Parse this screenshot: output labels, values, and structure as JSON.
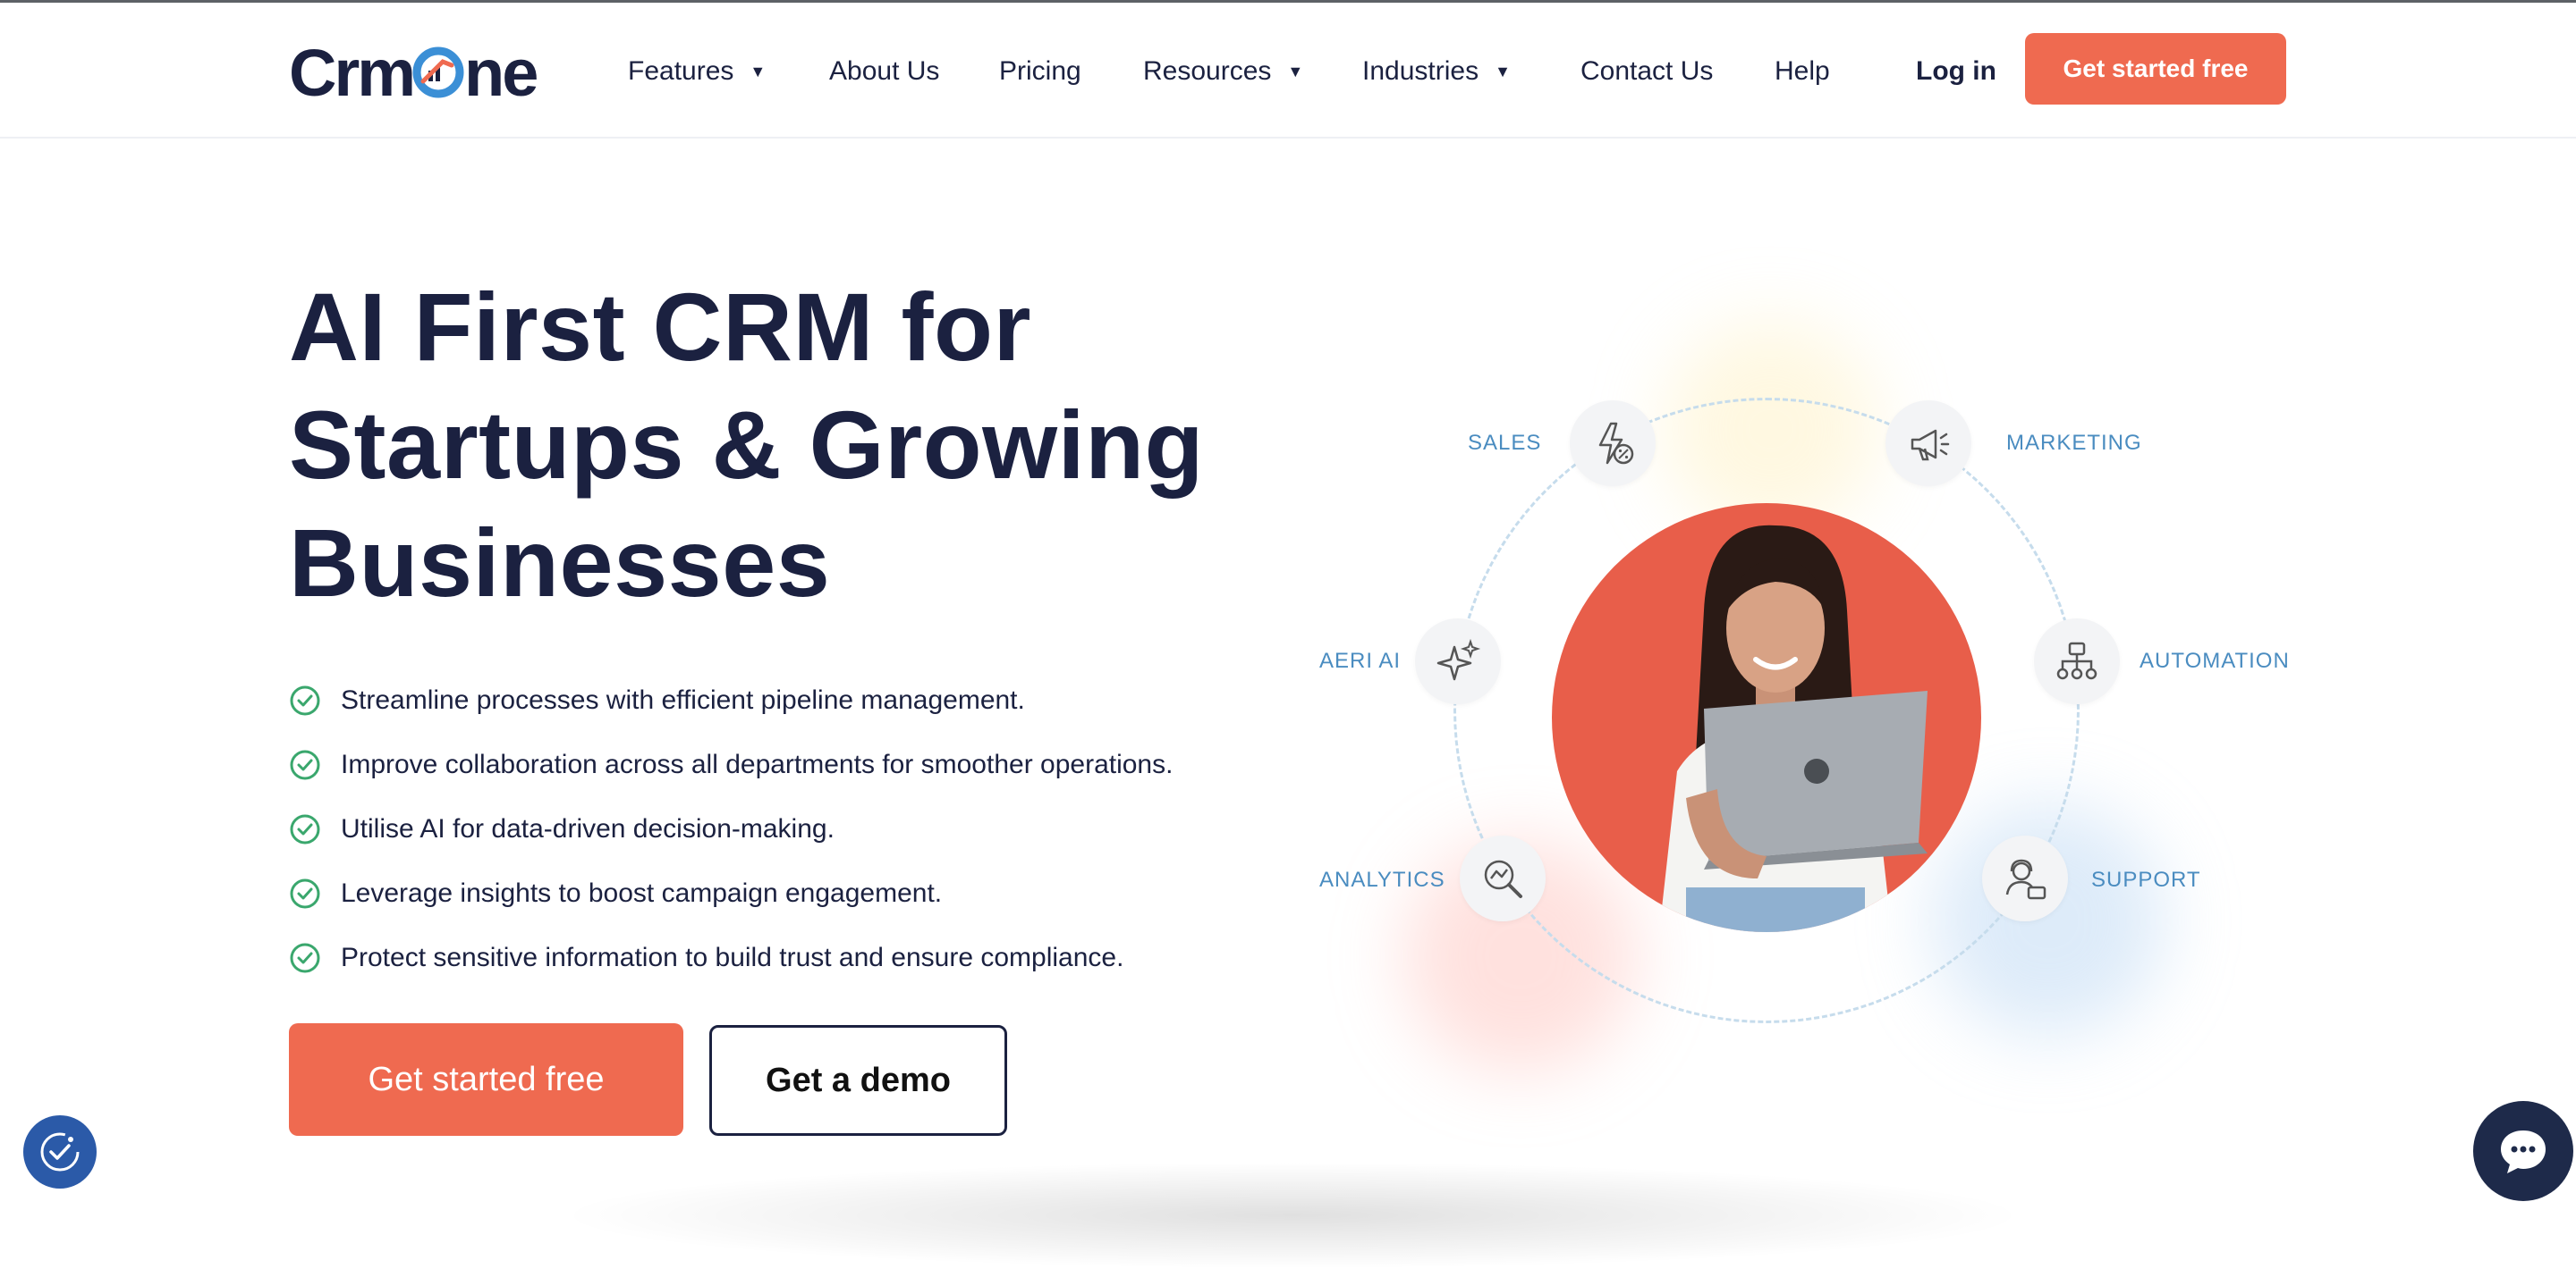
{
  "brand": {
    "logo_icon": "crmone-logo",
    "accent_color": "#ef6a50",
    "navy_color": "#1b2140",
    "label_color": "#4a8cc0"
  },
  "nav": {
    "items": [
      {
        "label": "Features",
        "has_dropdown": true
      },
      {
        "label": "About Us",
        "has_dropdown": false
      },
      {
        "label": "Pricing",
        "has_dropdown": false
      },
      {
        "label": "Resources",
        "has_dropdown": true
      },
      {
        "label": "Industries",
        "has_dropdown": true
      },
      {
        "label": "Contact Us",
        "has_dropdown": false
      },
      {
        "label": "Help",
        "has_dropdown": false
      }
    ],
    "login_label": "Log in",
    "cta_label": "Get started free"
  },
  "hero": {
    "title_lines": [
      "AI First CRM for",
      "Startups & Growing",
      "Businesses"
    ],
    "bullets": [
      "Streamline processes with efficient pipeline management.",
      "Improve collaboration across all departments for smoother operations.",
      "Utilise AI for data-driven decision-making.",
      "Leverage insights to boost campaign engagement.",
      "Protect sensitive information to build trust and ensure compliance."
    ],
    "primary_button": "Get started free",
    "secondary_button": "Get a demo"
  },
  "illustration": {
    "nodes": [
      {
        "label": "SALES",
        "icon": "sales-bolt-percent-icon"
      },
      {
        "label": "MARKETING",
        "icon": "megaphone-icon"
      },
      {
        "label": "AERI AI",
        "icon": "sparkles-icon"
      },
      {
        "label": "AUTOMATION",
        "icon": "workflow-icon"
      },
      {
        "label": "ANALYTICS",
        "icon": "analytics-search-icon"
      },
      {
        "label": "SUPPORT",
        "icon": "support-agent-icon"
      }
    ]
  },
  "widgets": {
    "accessibility_icon": "accessibility-check-icon",
    "chat_icon": "chat-bubble-icon"
  }
}
